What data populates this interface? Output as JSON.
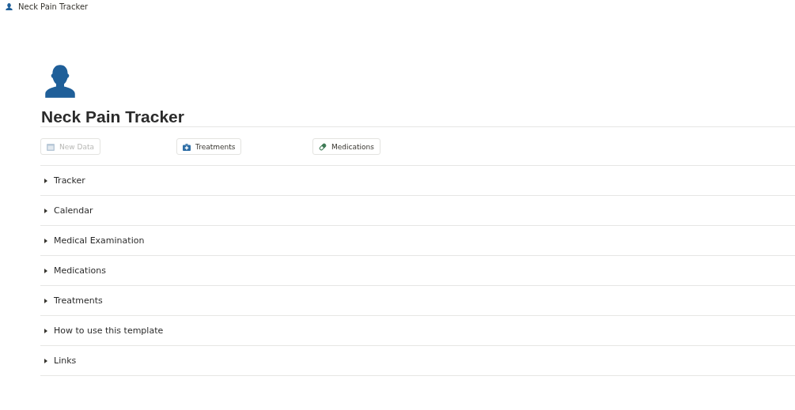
{
  "breadcrumb": {
    "title": "Neck Pain Tracker"
  },
  "page": {
    "title": "Neck Pain Tracker"
  },
  "buttons": [
    {
      "label": "New Data",
      "kind": "calendar",
      "disabled": true
    },
    {
      "label": "Treatments",
      "kind": "kit",
      "disabled": false
    },
    {
      "label": "Medications",
      "kind": "pill",
      "disabled": false
    }
  ],
  "toggles": [
    {
      "label": "Tracker",
      "expanded": false
    },
    {
      "label": "Calendar",
      "expanded": false
    },
    {
      "label": "Medical Examination",
      "expanded": false
    },
    {
      "label": "Medications",
      "expanded": false
    },
    {
      "label": "Treatments",
      "expanded": false
    },
    {
      "label": "How to use this template",
      "expanded": false
    },
    {
      "label": "Links",
      "expanded": false
    }
  ]
}
